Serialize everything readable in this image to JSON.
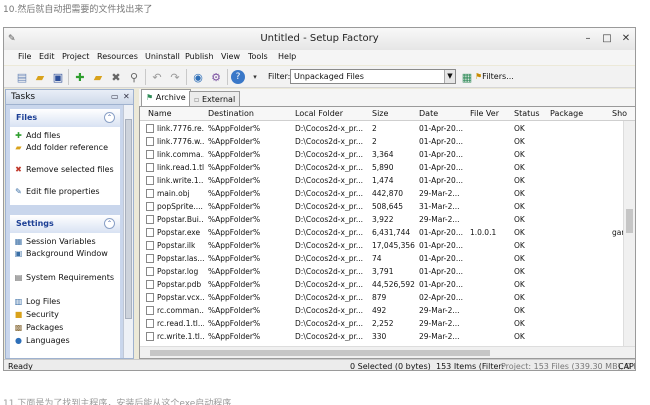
{
  "page": {
    "caption_top": "10.然后就自动把需要的文件找出来了",
    "caption_bottom": "11.下面是为了找到主程序，安装后能从这个exe启动程序"
  },
  "window": {
    "title": "Untitled - Setup Factory"
  },
  "menu": [
    "File",
    "Edit",
    "Project",
    "Resources",
    "Uninstall",
    "Publish",
    "View",
    "Tools",
    "Help"
  ],
  "toolbar": {
    "filter_label": "Filter:",
    "filter_value": "Unpackaged Files",
    "filters_button": "Filters..."
  },
  "tasks": {
    "title": "Tasks",
    "files_group": {
      "title": "Files",
      "items": [
        {
          "label": "Add files",
          "icon": "plus-icon",
          "color": "#2e9e2e"
        },
        {
          "label": "Add folder reference",
          "icon": "folder-add-icon",
          "color": "#d9a21b"
        },
        {
          "label": "Remove selected files",
          "icon": "remove-icon",
          "color": "#c0392b"
        },
        {
          "label": "Edit file properties",
          "icon": "edit-icon",
          "color": "#3a6ea5"
        }
      ]
    },
    "settings_group": {
      "title": "Settings",
      "items": [
        {
          "label": "Session Variables",
          "icon": "variables-icon",
          "color": "#3a6ea5"
        },
        {
          "label": "Background Window",
          "icon": "window-icon",
          "color": "#3a6ea5"
        },
        {
          "label": "System Requirements",
          "icon": "requirements-icon",
          "color": "#555"
        },
        {
          "label": "Log Files",
          "icon": "log-icon",
          "color": "#3a6ea5"
        },
        {
          "label": "Security",
          "icon": "lock-icon",
          "color": "#d9a21b"
        },
        {
          "label": "Packages",
          "icon": "package-icon",
          "color": "#8a6d3b"
        },
        {
          "label": "Languages",
          "icon": "globe-icon",
          "color": "#2e6fb8"
        }
      ]
    }
  },
  "tabs": [
    {
      "label": "Archive",
      "active": true
    },
    {
      "label": "External",
      "active": false
    }
  ],
  "columns": [
    "Name",
    "Destination",
    "Local Folder",
    "Size",
    "Date",
    "File Ver",
    "Status",
    "Package",
    "Sho"
  ],
  "rows": [
    [
      "link.7776.re...",
      "%AppFolder%",
      "D:\\Cocos2d-x_pr...",
      "2",
      "01-Apr-20...",
      "",
      "OK",
      "",
      ""
    ],
    [
      "link.7776.w...",
      "%AppFolder%",
      "D:\\Cocos2d-x_pr...",
      "2",
      "01-Apr-20...",
      "",
      "OK",
      "",
      ""
    ],
    [
      "link.comma...",
      "%AppFolder%",
      "D:\\Cocos2d-x_pr...",
      "3,364",
      "01-Apr-20...",
      "",
      "OK",
      "",
      ""
    ],
    [
      "link.read.1.tl...",
      "%AppFolder%",
      "D:\\Cocos2d-x_pr...",
      "5,890",
      "01-Apr-20...",
      "",
      "OK",
      "",
      ""
    ],
    [
      "link.write.1....",
      "%AppFolder%",
      "D:\\Cocos2d-x_pr...",
      "1,474",
      "01-Apr-20...",
      "",
      "OK",
      "",
      ""
    ],
    [
      "main.obj",
      "%AppFolder%",
      "D:\\Cocos2d-x_pr...",
      "442,870",
      "29-Mar-2...",
      "",
      "OK",
      "",
      ""
    ],
    [
      "popSprite....",
      "%AppFolder%",
      "D:\\Cocos2d-x_pr...",
      "508,645",
      "31-Mar-2...",
      "",
      "OK",
      "",
      ""
    ],
    [
      "Popstar.Bui...",
      "%AppFolder%",
      "D:\\Cocos2d-x_pr...",
      "3,922",
      "29-Mar-2...",
      "",
      "OK",
      "",
      ""
    ],
    [
      "Popstar.exe",
      "%AppFolder%",
      "D:\\Cocos2d-x_pr...",
      "6,431,744",
      "01-Apr-20...",
      "1.0.0.1",
      "OK",
      "",
      "gar"
    ],
    [
      "Popstar.ilk",
      "%AppFolder%",
      "D:\\Cocos2d-x_pr...",
      "17,045,356",
      "01-Apr-20...",
      "",
      "OK",
      "",
      ""
    ],
    [
      "Popstar.las...",
      "%AppFolder%",
      "D:\\Cocos2d-x_pr...",
      "74",
      "01-Apr-20...",
      "",
      "OK",
      "",
      ""
    ],
    [
      "Popstar.log",
      "%AppFolder%",
      "D:\\Cocos2d-x_pr...",
      "3,791",
      "01-Apr-20...",
      "",
      "OK",
      "",
      ""
    ],
    [
      "Popstar.pdb",
      "%AppFolder%",
      "D:\\Cocos2d-x_pr...",
      "44,526,592",
      "01-Apr-20...",
      "",
      "OK",
      "",
      ""
    ],
    [
      "Popstar.vcx...",
      "%AppFolder%",
      "D:\\Cocos2d-x_pr...",
      "879",
      "02-Apr-20...",
      "",
      "OK",
      "",
      ""
    ],
    [
      "rc.comman...",
      "%AppFolder%",
      "D:\\Cocos2d-x_pr...",
      "492",
      "29-Mar-2...",
      "",
      "OK",
      "",
      ""
    ],
    [
      "rc.read.1.tl...",
      "%AppFolder%",
      "D:\\Cocos2d-x_pr...",
      "2,252",
      "29-Mar-2...",
      "",
      "OK",
      "",
      ""
    ],
    [
      "rc.write.1.tl...",
      "%AppFolder%",
      "D:\\Cocos2d-x_pr...",
      "330",
      "29-Mar-2...",
      "",
      "OK",
      "",
      ""
    ]
  ],
  "status": {
    "left": "Ready",
    "selected": "0 Selected (0 bytes)",
    "items": "153 Items (Filter:",
    "project": "Project: 153 Files (339.30 MB), 0 Fo",
    "caps": "CAP"
  }
}
